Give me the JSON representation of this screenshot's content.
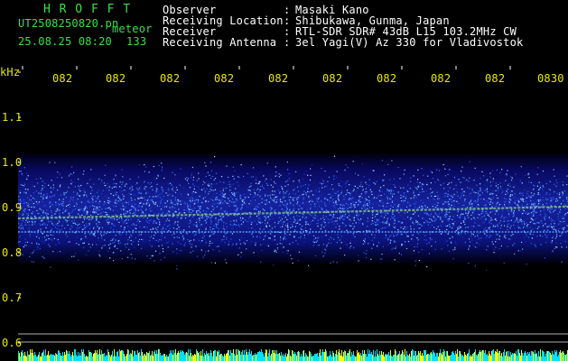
{
  "header": {
    "brand": "H R O F F T",
    "filename": "UT2508250820.pn",
    "mode": "meteor",
    "datetime": "25.08.25 08:20",
    "count": "133",
    "labels": [
      "Observer",
      "Receiving Location",
      "Receiver",
      "Receiving Antenna"
    ],
    "separator": ":",
    "values": [
      "Masaki Kano",
      "Shibukawa, Gunma, Japan",
      "RTL-SDR SDR# 43dB L15 103.2MHz CW",
      "3el Yagi(V) Az 330 for Vladivostok"
    ]
  },
  "time_axis": {
    "ticks": [
      "082",
      "082",
      "082",
      "082",
      "082",
      "082",
      "082",
      "082",
      "082",
      "0830"
    ]
  },
  "freq_axis": {
    "unit": "kHz",
    "ticks": [
      "1.1",
      "1.0",
      "0.9",
      "0.8",
      "0.7",
      "0.6"
    ]
  },
  "colors": {
    "header_text": "#38e04a",
    "info_text": "#ffffff",
    "axis_text": "#e8e800",
    "tick_marks": "#ffffff",
    "band_dark": "#1414a0",
    "band_bright": "#4aa0ff",
    "signal_line": "#8ad27a",
    "bottom_bar_cyan": "#00e0ff",
    "bottom_bar_yellow": "#ffff00"
  }
}
